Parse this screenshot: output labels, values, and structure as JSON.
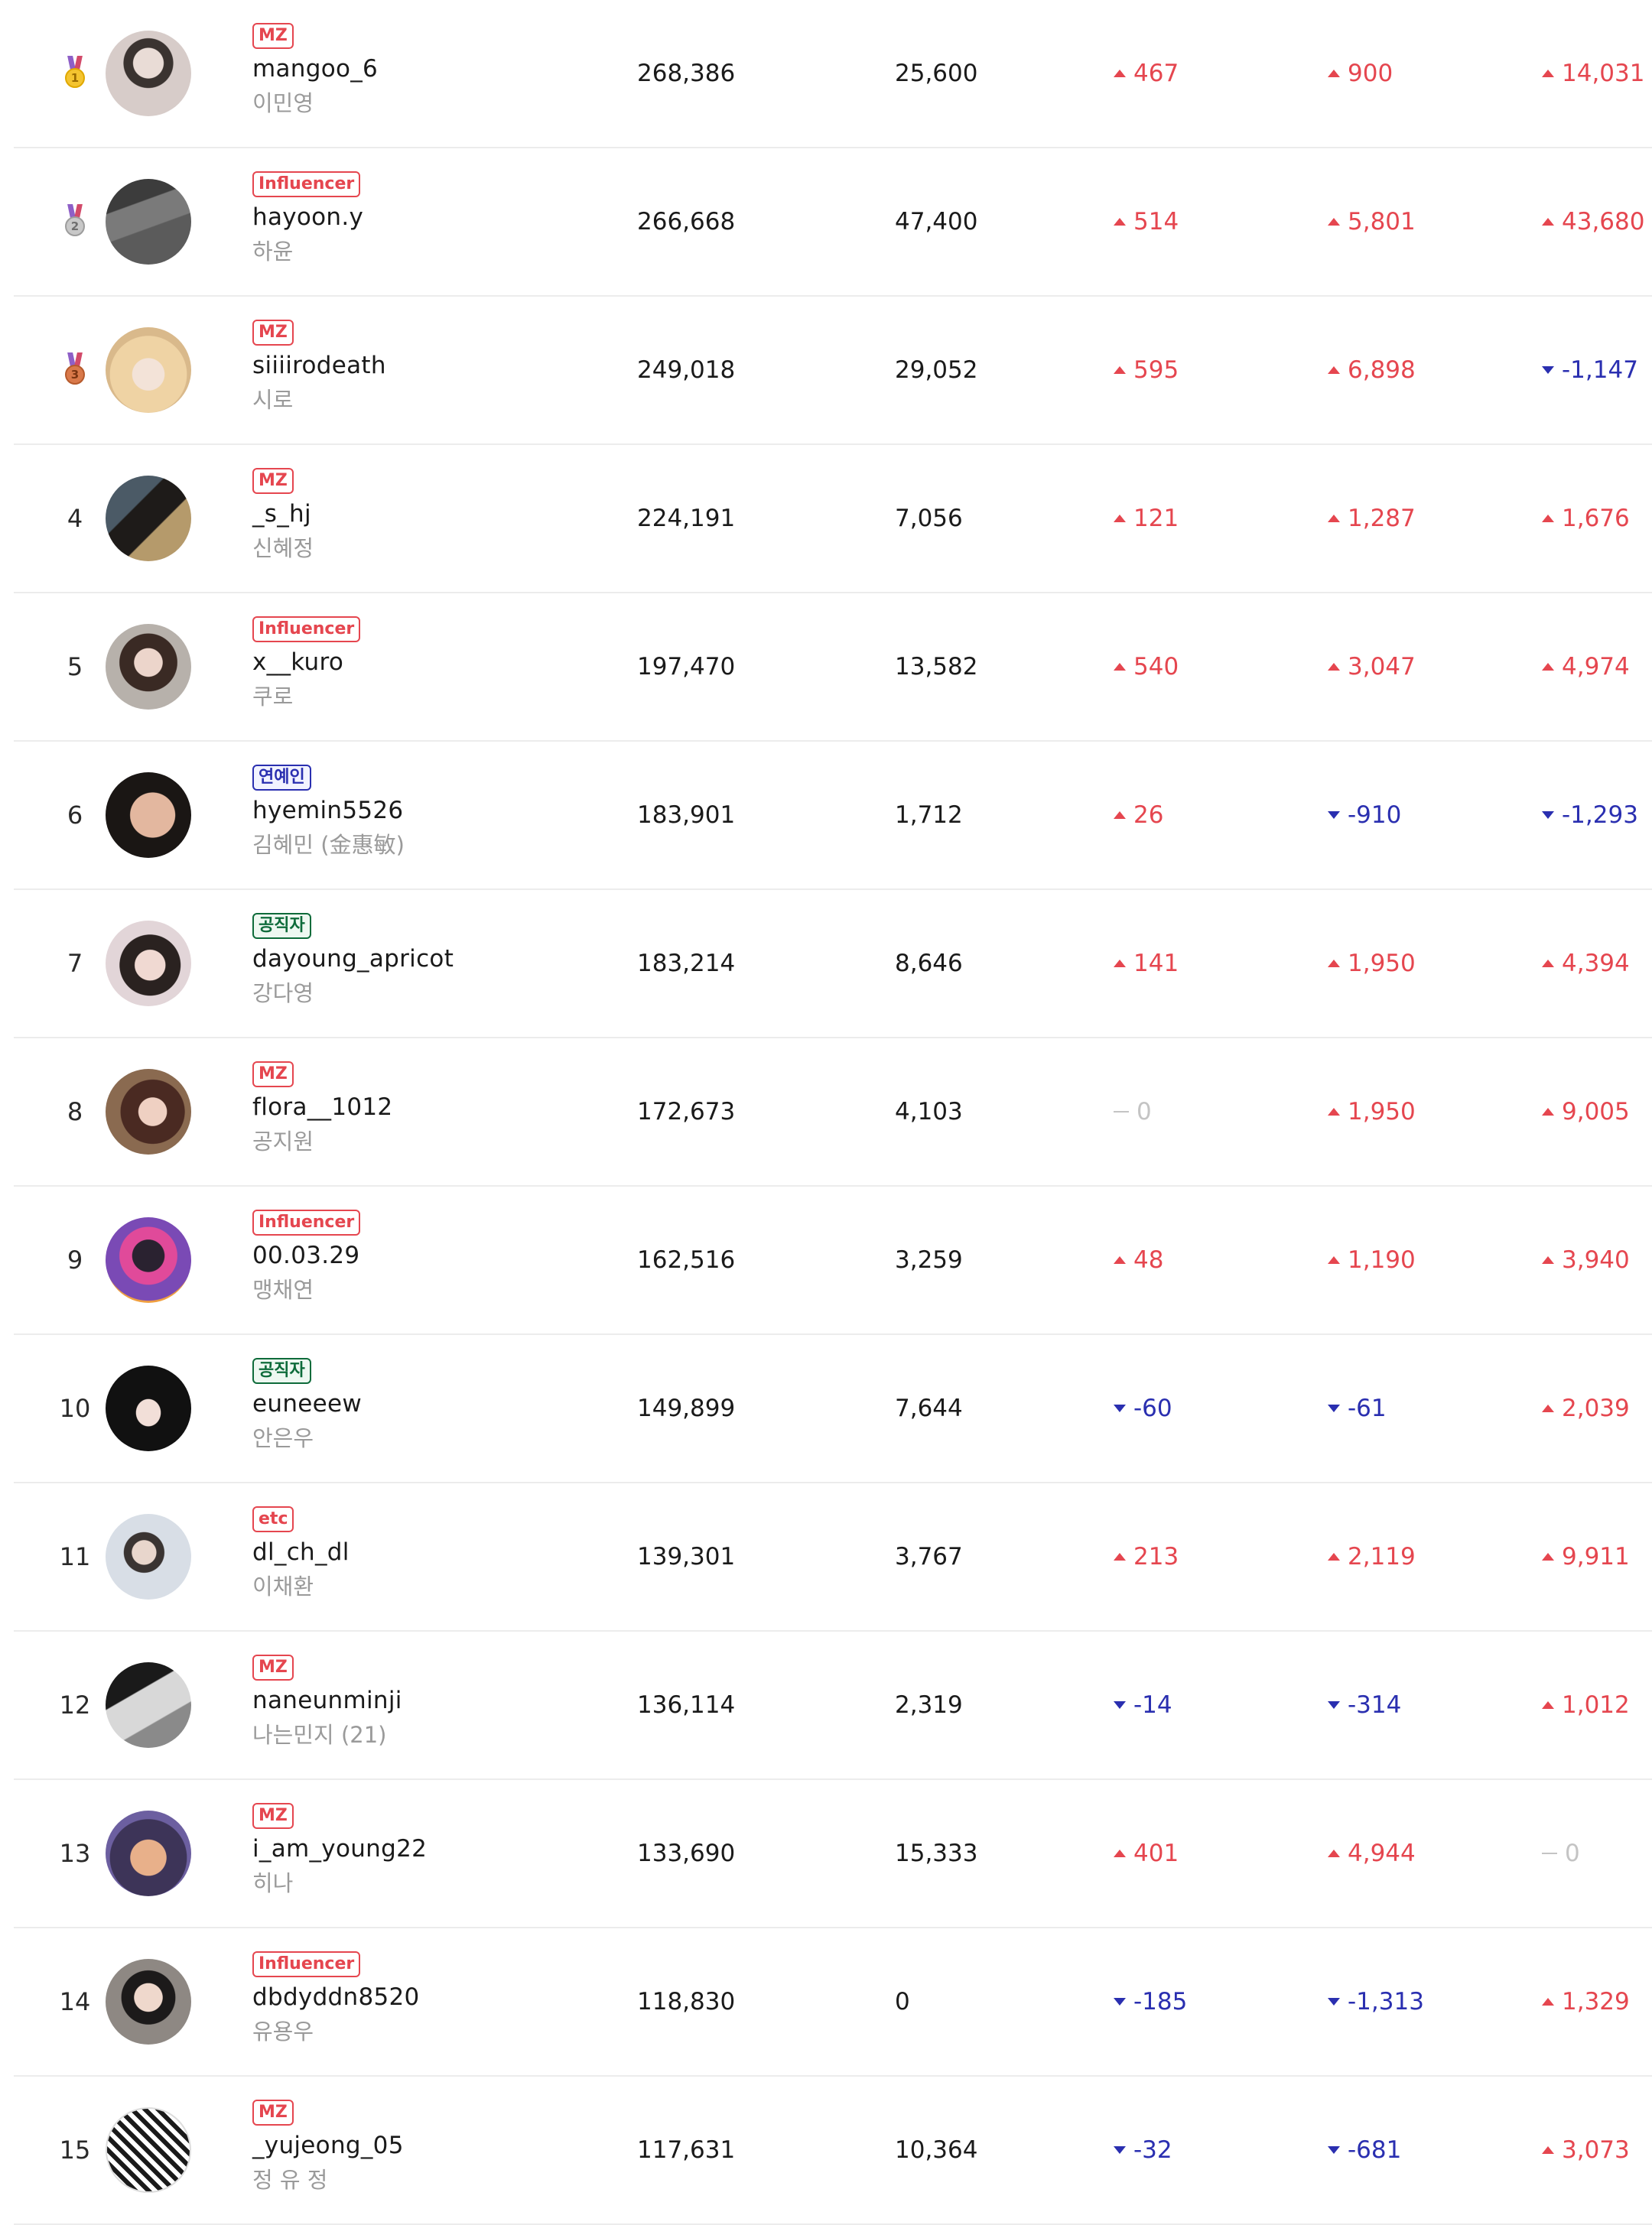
{
  "rows": [
    {
      "rank": "1",
      "medal": "gold",
      "medal_num": "1",
      "badge": "MZ",
      "badge_type": "mz",
      "username": "mangoo_6",
      "realname": "이민영",
      "followers": "268,386",
      "following": "25,600",
      "d1": "467",
      "d1_dir": "up",
      "d2": "900",
      "d2_dir": "up",
      "d3": "14,031",
      "d3_dir": "up"
    },
    {
      "rank": "2",
      "medal": "silver",
      "medal_num": "2",
      "badge": "Influencer",
      "badge_type": "influencer",
      "username": "hayoon.y",
      "realname": "하윤",
      "followers": "266,668",
      "following": "47,400",
      "d1": "514",
      "d1_dir": "up",
      "d2": "5,801",
      "d2_dir": "up",
      "d3": "43,680",
      "d3_dir": "up"
    },
    {
      "rank": "3",
      "medal": "bronze",
      "medal_num": "3",
      "badge": "MZ",
      "badge_type": "mz",
      "username": "siiiirodeath",
      "realname": "시로",
      "followers": "249,018",
      "following": "29,052",
      "d1": "595",
      "d1_dir": "up",
      "d2": "6,898",
      "d2_dir": "up",
      "d3": "-1,147",
      "d3_dir": "down"
    },
    {
      "rank": "4",
      "medal": "",
      "badge": "MZ",
      "badge_type": "mz",
      "username": "_s_hj",
      "realname": "신혜정",
      "followers": "224,191",
      "following": "7,056",
      "d1": "121",
      "d1_dir": "up",
      "d2": "1,287",
      "d2_dir": "up",
      "d3": "1,676",
      "d3_dir": "up"
    },
    {
      "rank": "5",
      "medal": "",
      "badge": "Influencer",
      "badge_type": "influencer",
      "username": "x__kuro",
      "realname": "쿠로",
      "followers": "197,470",
      "following": "13,582",
      "d1": "540",
      "d1_dir": "up",
      "d2": "3,047",
      "d2_dir": "up",
      "d3": "4,974",
      "d3_dir": "up"
    },
    {
      "rank": "6",
      "medal": "",
      "badge": "연예인",
      "badge_type": "celeb",
      "username": "hyemin5526",
      "realname": "김혜민 (金惠敏)",
      "followers": "183,901",
      "following": "1,712",
      "d1": "26",
      "d1_dir": "up",
      "d2": "-910",
      "d2_dir": "down",
      "d3": "-1,293",
      "d3_dir": "down"
    },
    {
      "rank": "7",
      "medal": "",
      "badge": "공직자",
      "badge_type": "public",
      "username": "dayoung_apricot",
      "realname": "강다영",
      "followers": "183,214",
      "following": "8,646",
      "d1": "141",
      "d1_dir": "up",
      "d2": "1,950",
      "d2_dir": "up",
      "d3": "4,394",
      "d3_dir": "up"
    },
    {
      "rank": "8",
      "medal": "",
      "badge": "MZ",
      "badge_type": "mz",
      "username": "flora__1012",
      "realname": "공지원",
      "followers": "172,673",
      "following": "4,103",
      "d1": "0",
      "d1_dir": "flat",
      "d2": "1,950",
      "d2_dir": "up",
      "d3": "9,005",
      "d3_dir": "up"
    },
    {
      "rank": "9",
      "medal": "",
      "badge": "Influencer",
      "badge_type": "influencer",
      "username": "00.03.29",
      "realname": "맹채연",
      "followers": "162,516",
      "following": "3,259",
      "d1": "48",
      "d1_dir": "up",
      "d2": "1,190",
      "d2_dir": "up",
      "d3": "3,940",
      "d3_dir": "up"
    },
    {
      "rank": "10",
      "medal": "",
      "badge": "공직자",
      "badge_type": "public",
      "username": "euneeew",
      "realname": "안은우",
      "followers": "149,899",
      "following": "7,644",
      "d1": "-60",
      "d1_dir": "down",
      "d2": "-61",
      "d2_dir": "down",
      "d3": "2,039",
      "d3_dir": "up"
    },
    {
      "rank": "11",
      "medal": "",
      "badge": "etc",
      "badge_type": "etc",
      "username": "dl_ch_dl",
      "realname": "이채환",
      "followers": "139,301",
      "following": "3,767",
      "d1": "213",
      "d1_dir": "up",
      "d2": "2,119",
      "d2_dir": "up",
      "d3": "9,911",
      "d3_dir": "up"
    },
    {
      "rank": "12",
      "medal": "",
      "badge": "MZ",
      "badge_type": "mz",
      "username": "naneunminji",
      "realname": "나는민지 (21)",
      "followers": "136,114",
      "following": "2,319",
      "d1": "-14",
      "d1_dir": "down",
      "d2": "-314",
      "d2_dir": "down",
      "d3": "1,012",
      "d3_dir": "up"
    },
    {
      "rank": "13",
      "medal": "",
      "badge": "MZ",
      "badge_type": "mz",
      "username": "i_am_young22",
      "realname": "히나",
      "followers": "133,690",
      "following": "15,333",
      "d1": "401",
      "d1_dir": "up",
      "d2": "4,944",
      "d2_dir": "up",
      "d3": "0",
      "d3_dir": "flat"
    },
    {
      "rank": "14",
      "medal": "",
      "badge": "Influencer",
      "badge_type": "influencer",
      "username": "dbdyddn8520",
      "realname": "유용우",
      "followers": "118,830",
      "following": "0",
      "d1": "-185",
      "d1_dir": "down",
      "d2": "-1,313",
      "d2_dir": "down",
      "d3": "1,329",
      "d3_dir": "up"
    },
    {
      "rank": "15",
      "medal": "",
      "badge": "MZ",
      "badge_type": "mz",
      "username": "_yujeong_05",
      "realname": "정 유 정",
      "followers": "117,631",
      "following": "10,364",
      "d1": "-32",
      "d1_dir": "down",
      "d2": "-681",
      "d2_dir": "down",
      "d3": "3,073",
      "d3_dir": "up"
    }
  ],
  "avatar_colors": [
    "#c9c2c4",
    "#4a4a4a",
    "#e8d2a8",
    "#2d2b29",
    "#3b2d28",
    "#1d1a18",
    "#d8c7cd",
    "#5a3a32",
    "#b53c7b",
    "#121212",
    "#cfd6df",
    "#7a7a7a",
    "#5b4d7c",
    "#6a6560",
    "#2a2a2a"
  ]
}
